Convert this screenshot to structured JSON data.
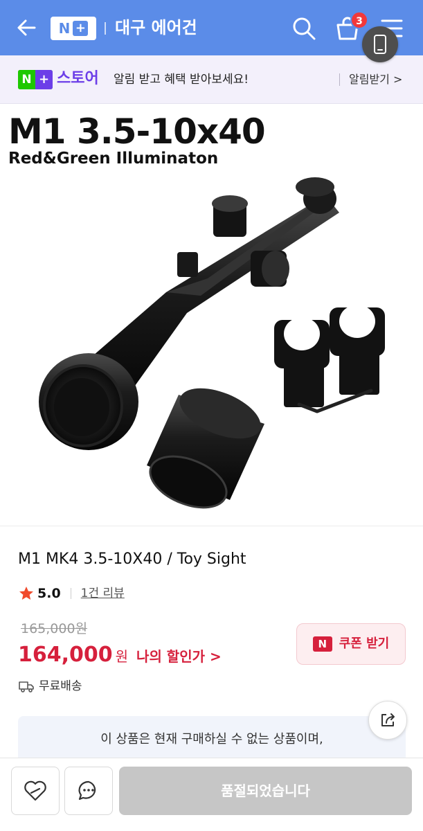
{
  "header": {
    "logo_n": "N",
    "logo_plus": "+",
    "title": "대구 에어건",
    "cart_count": "3",
    "bg_color": "#5b8ce8"
  },
  "store_banner": {
    "logo_n": "N",
    "logo_plus": "+",
    "store_label": "스토어",
    "message": "알림 받고 혜택 받아보세요!",
    "action_label": "알림받기 >"
  },
  "product_image": {
    "title": "M1 3.5-10x40",
    "subtitle": "Red&Green Illuminaton"
  },
  "product": {
    "name": "M1 MK4 3.5-10X40 / Toy Sight",
    "rating": "5.0",
    "review_link": "1건 리뷰",
    "original_price": "165,000원",
    "price": "164,000",
    "price_unit": "원",
    "my_discount": "나의 할인가 >",
    "coupon_icon": "N",
    "coupon_label": "쿠폰 받기",
    "shipping": "무료배송",
    "accent_color": "#d6203c"
  },
  "notice": {
    "text": "이 상품은 현재 구매하실 수 없는 상품이며,"
  },
  "bottom_bar": {
    "soldout_label": "품절되었습니다"
  },
  "icons": {
    "back": "back-arrow-icon",
    "search": "search-icon",
    "cart": "cart-icon",
    "menu": "menu-icon",
    "phone": "phone-icon",
    "star": "star-icon",
    "truck": "truck-icon",
    "share": "share-icon",
    "wish": "heart-icon",
    "chat": "chat-icon"
  }
}
